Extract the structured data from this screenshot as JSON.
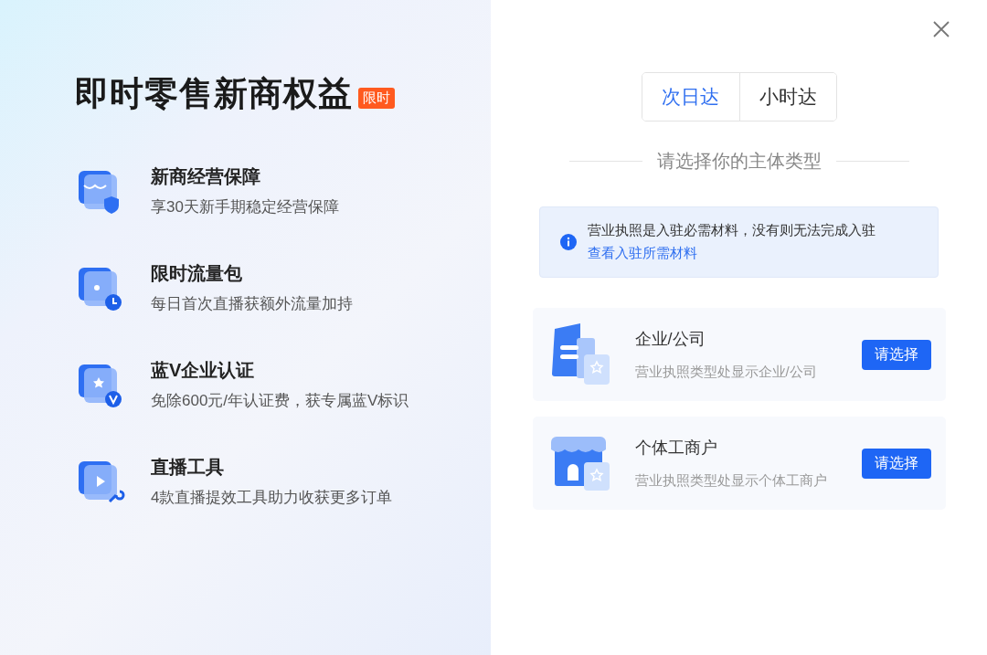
{
  "promo": {
    "title": "即时零售新商权益",
    "badge": "限时",
    "benefits": [
      {
        "kind": "shield",
        "title": "新商经营保障",
        "description": "享30天新手期稳定经营保障"
      },
      {
        "kind": "clock",
        "title": "限时流量包",
        "description": "每日首次直播获额外流量加持"
      },
      {
        "kind": "verified",
        "title": "蓝V企业认证",
        "description": "免除600元/年认证费，获专属蓝V标识"
      },
      {
        "kind": "tool",
        "title": "直播工具",
        "description": "4款直播提效工具助力收获更多订单"
      }
    ]
  },
  "selector": {
    "tabs": [
      {
        "label": "次日达",
        "selected": true
      },
      {
        "label": "小时达",
        "selected": false
      }
    ],
    "heading": "请选择你的主体类型",
    "notice": {
      "text": "营业执照是入驻必需材料，没有则无法完成入驻",
      "link": "查看入驻所需材料"
    },
    "entity_types": [
      {
        "kind": "company",
        "name": "企业/公司",
        "hint": "营业执照类型处显示企业/公司",
        "button": "请选择"
      },
      {
        "kind": "store",
        "name": "个体工商户",
        "hint": "营业执照类型处显示个体工商户",
        "button": "请选择"
      }
    ]
  }
}
